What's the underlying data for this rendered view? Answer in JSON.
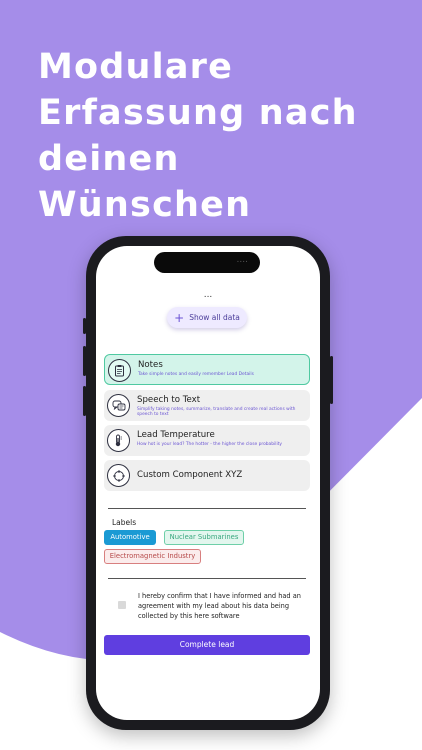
{
  "colors": {
    "background_purple": "#a58de9",
    "accent": "#5f3ee0",
    "active_card_bg": "#d3f4ea",
    "active_card_border": "#4fc9a1"
  },
  "headline": {
    "line1": "Modulare",
    "line2": "Erfassung nach",
    "line3": "deinen",
    "line4": "Wünschen"
  },
  "phone": {
    "island_indicator": "....",
    "menu_dots": "...",
    "show_all": {
      "icon": "plus-icon",
      "label": "Show all data"
    },
    "modules": [
      {
        "title": "Notes",
        "description": "Take simple notes and easily remember Lead Details",
        "icon": "clipboard-icon",
        "active": true
      },
      {
        "title": "Speech to Text",
        "description": "Simplify taking notes, summarize, translate and create real actions with speech to text",
        "icon": "speech-icon",
        "active": false
      },
      {
        "title": "Lead Temperature",
        "description": "How hot is your lead? The hotter - the higher the close probability",
        "icon": "thermometer-icon",
        "active": false
      },
      {
        "title": "Custom Component XYZ",
        "description": "",
        "icon": "crosshair-icon",
        "active": false
      }
    ],
    "labels": {
      "title": "Labels",
      "chips": [
        "Automotive",
        "Nuclear Submarines",
        "Electromagnetic Industry"
      ]
    },
    "confirmation": {
      "text": "I hereby confirm that I have informed and had an agreement with my lead about his data being collected by this here software",
      "checked": false
    },
    "complete_button": "Complete lead"
  }
}
